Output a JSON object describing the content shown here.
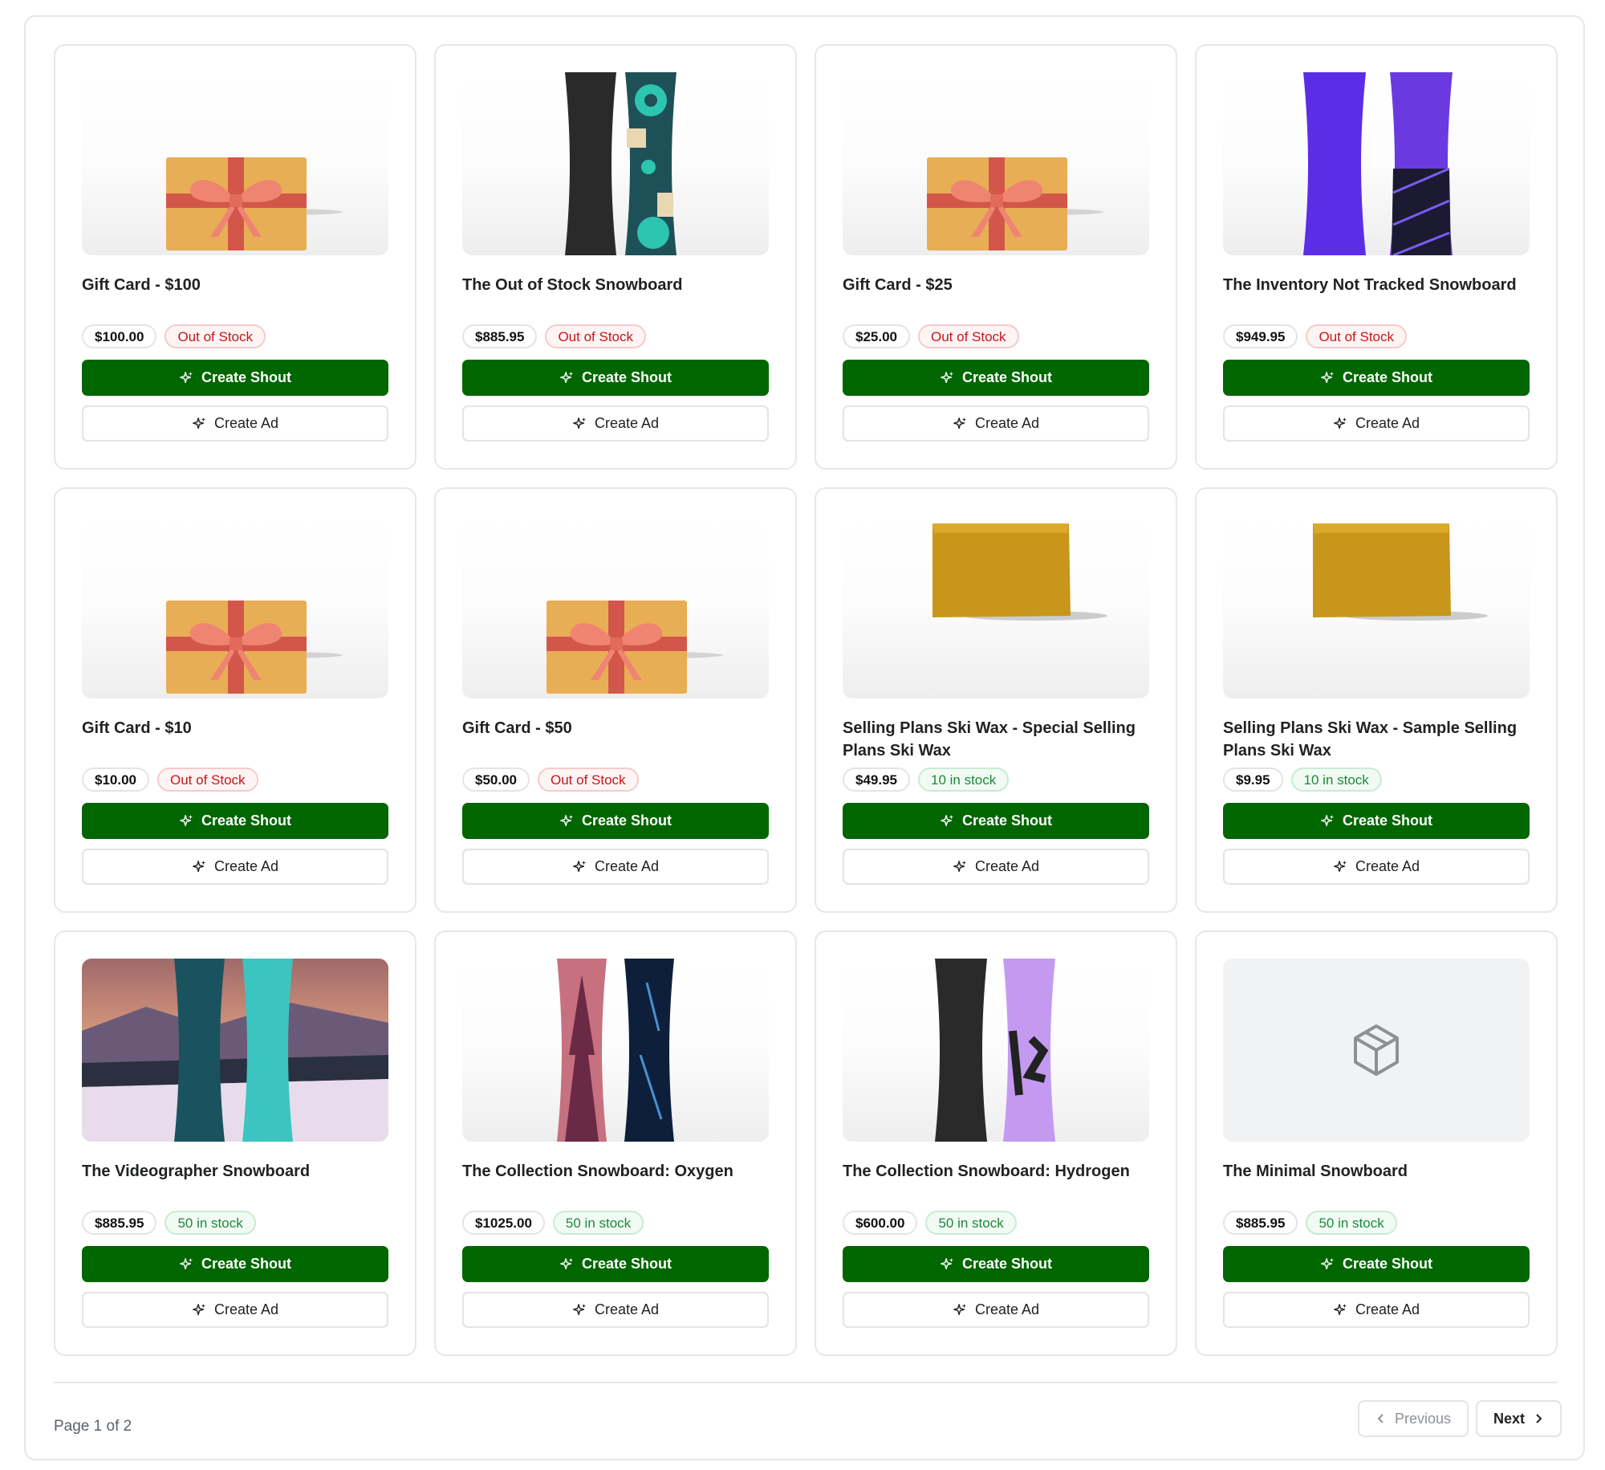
{
  "products": [
    {
      "title": "Gift Card - $100",
      "price": "$100.00",
      "stock": "Out of Stock",
      "in_stock": false,
      "image": "gift-card"
    },
    {
      "title": "The Out of Stock Snowboard",
      "price": "$885.95",
      "stock": "Out of Stock",
      "in_stock": false,
      "image": "snowboard-black-teal"
    },
    {
      "title": "Gift Card - $25",
      "price": "$25.00",
      "stock": "Out of Stock",
      "in_stock": false,
      "image": "gift-card"
    },
    {
      "title": "The Inventory Not Tracked Snowboard",
      "price": "$949.95",
      "stock": "Out of Stock",
      "in_stock": false,
      "image": "snowboard-purple"
    },
    {
      "title": "Gift Card - $10",
      "price": "$10.00",
      "stock": "Out of Stock",
      "in_stock": false,
      "image": "gift-card"
    },
    {
      "title": "Gift Card - $50",
      "price": "$50.00",
      "stock": "Out of Stock",
      "in_stock": false,
      "image": "gift-card"
    },
    {
      "title": "Selling Plans Ski Wax - Special Selling Plans Ski Wax",
      "price": "$49.95",
      "stock": "10 in stock",
      "in_stock": true,
      "image": "ski-wax"
    },
    {
      "title": "Selling Plans Ski Wax - Sample Selling Plans Ski Wax",
      "price": "$9.95",
      "stock": "10 in stock",
      "in_stock": true,
      "image": "ski-wax"
    },
    {
      "title": "The Videographer Snowboard",
      "price": "$885.95",
      "stock": "50 in stock",
      "in_stock": true,
      "image": "snowboard-hydrogen-scene"
    },
    {
      "title": "The Collection Snowboard: Oxygen",
      "price": "$1025.00",
      "stock": "50 in stock",
      "in_stock": true,
      "image": "snowboard-oxygen"
    },
    {
      "title": "The Collection Snowboard: Hydrogen",
      "price": "$600.00",
      "stock": "50 in stock",
      "in_stock": true,
      "image": "snowboard-hydrogen"
    },
    {
      "title": "The Minimal Snowboard",
      "price": "$885.95",
      "stock": "50 in stock",
      "in_stock": true,
      "image": "placeholder-box"
    }
  ],
  "actions": {
    "shout_label": "Create Shout",
    "ad_label": "Create Ad",
    "icon": "sparkle-icon"
  },
  "colors": {
    "primary": "#006600",
    "out_of_stock": "#c4161c",
    "in_stock": "#1c8a3a"
  },
  "pagination": {
    "page_text": "Page 1 of 2",
    "previous_label": "Previous",
    "next_label": "Next"
  }
}
